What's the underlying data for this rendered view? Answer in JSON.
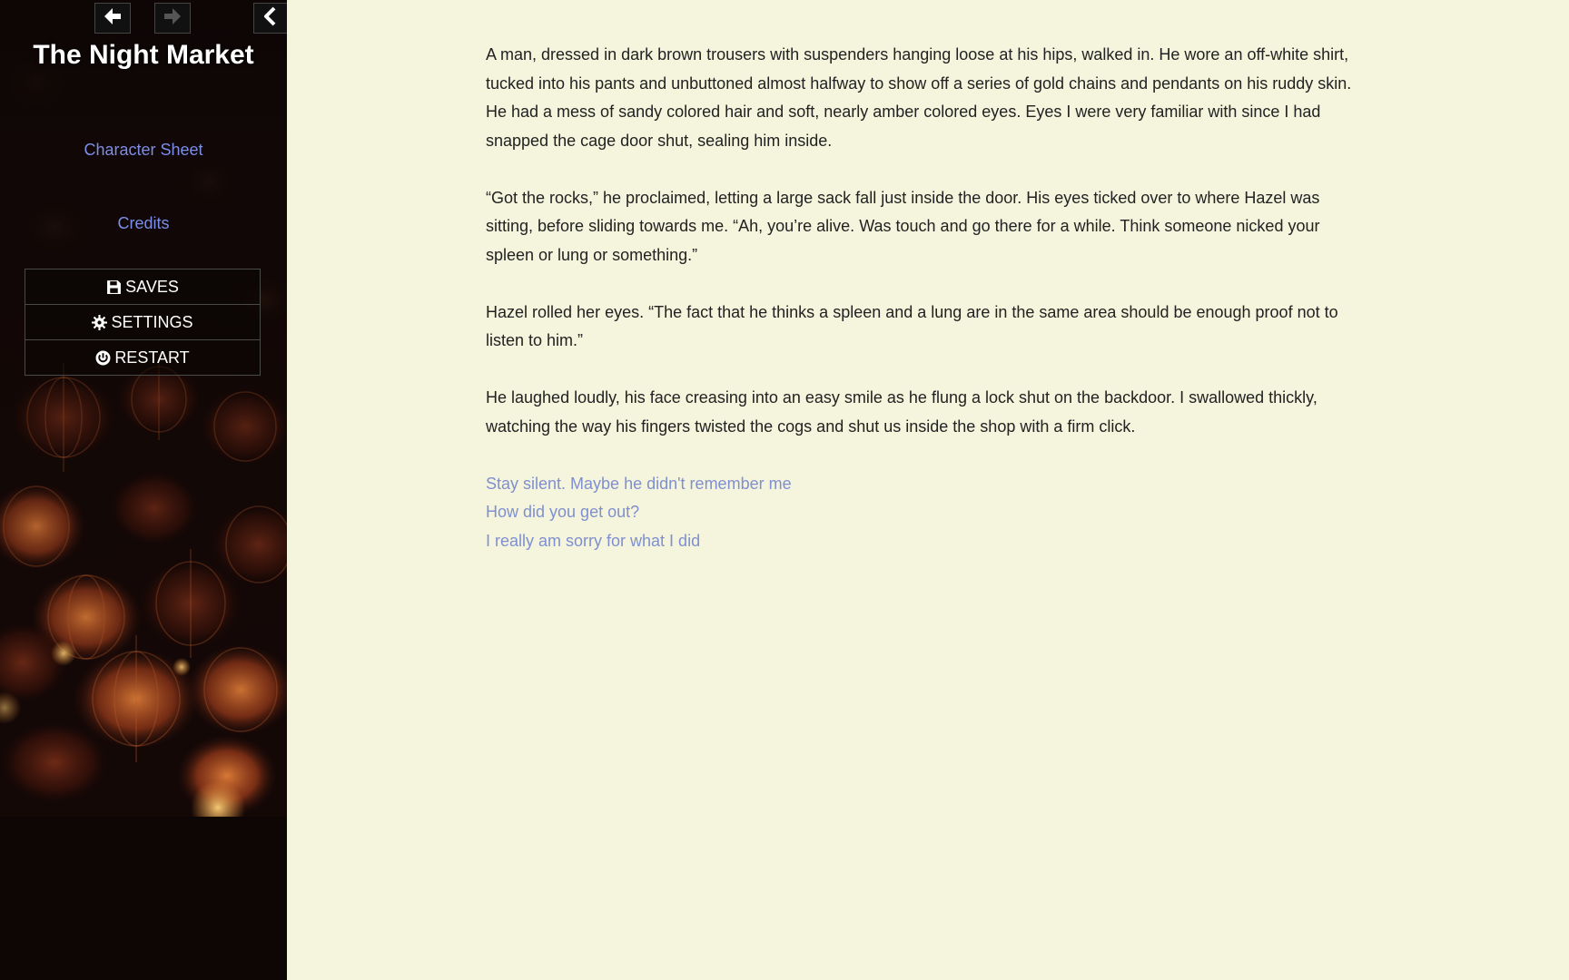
{
  "sidebar": {
    "title": "The Night Market",
    "nav": {
      "back_icon": "arrow-left-icon",
      "forward_icon": "arrow-right-icon",
      "collapse_icon": "chevron-left-icon"
    },
    "links": {
      "character_sheet": "Character Sheet",
      "credits": "Credits"
    },
    "menu": [
      {
        "label": "SAVES",
        "icon": "floppy-disk-icon"
      },
      {
        "label": "SETTINGS",
        "icon": "gear-icon"
      },
      {
        "label": "RESTART",
        "icon": "power-icon"
      }
    ]
  },
  "story": {
    "paragraphs": [
      "A man, dressed in dark brown trousers with suspenders hanging loose at his hips, walked in. He wore an off-white shirt, tucked into his pants and unbuttoned almost halfway to show off a series of gold chains and pendants on his ruddy skin. He had a mess of sandy colored hair and soft, nearly amber colored eyes. Eyes I were very familiar with since I had snapped the cage door shut, sealing him inside.",
      "“Got the rocks,” he proclaimed, letting a large sack fall just inside the door. His eyes ticked over to where Hazel was sitting, before sliding towards me. “Ah, you’re alive. Was touch and go there for a while. Think someone nicked your spleen or lung or something.”",
      "Hazel rolled her eyes. “The fact that he thinks a spleen and a lung are in the same area should be enough proof not to listen to him.”",
      "He laughed loudly, his face creasing into an easy smile as he flung a lock shut on the backdoor. I swallowed thickly, watching the way his fingers twisted the cogs and shut us inside the shop with a firm click."
    ],
    "choices": [
      "Stay silent. Maybe he didn't remember me",
      "How did you get out?",
      "I really am sorry for what I did"
    ]
  },
  "colors": {
    "sidebar_bg": "#0d0605",
    "page_bg": "#f5f5dd",
    "link": "#7c8ee8",
    "choice": "#7f8fcf",
    "text": "#222222"
  }
}
